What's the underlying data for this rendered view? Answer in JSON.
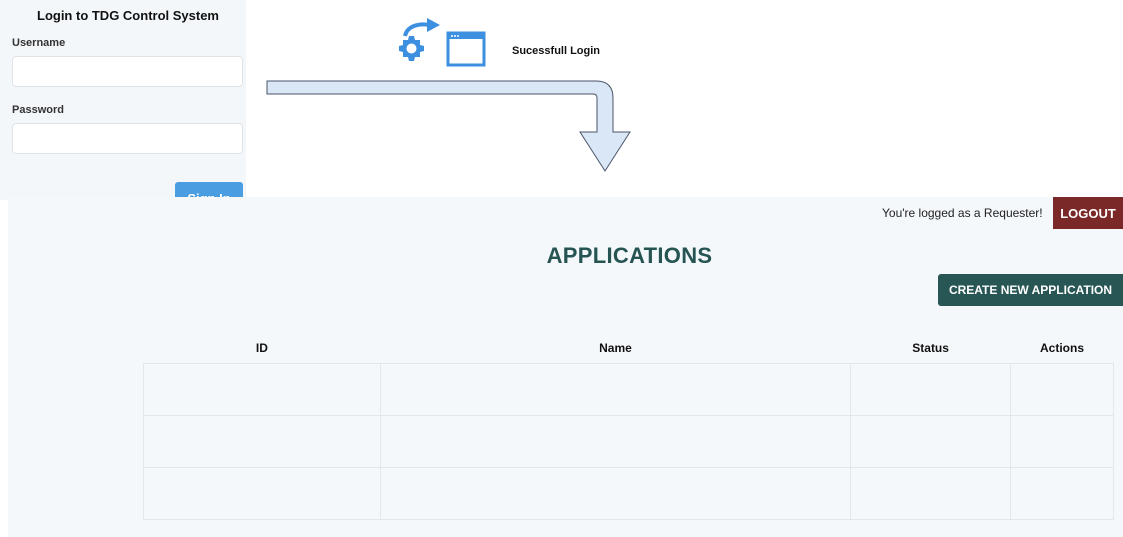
{
  "login": {
    "title": "Login to TDG Control System",
    "username_label": "Username",
    "username_value": "",
    "password_label": "Password",
    "password_value": "",
    "signin_label": "Sign In"
  },
  "transition": {
    "success_text": "Sucessfull Login",
    "icon_colors": {
      "accent": "#3d8fe0",
      "arrow_fill": "#d9e7f7"
    }
  },
  "header": {
    "logged_as": "You're logged as a Requester!",
    "logout_label": "LOGOUT"
  },
  "applications": {
    "title": "APPLICATIONS",
    "create_label": "CREATE NEW APPLICATION",
    "columns": [
      "ID",
      "Name",
      "Status",
      "Actions"
    ],
    "rows": [
      [
        "",
        "",
        "",
        ""
      ],
      [
        "",
        "",
        "",
        ""
      ],
      [
        "",
        "",
        "",
        ""
      ]
    ]
  },
  "colors": {
    "primary_teal": "#285654",
    "logout_red": "#7a2828",
    "signin_blue": "#4a9de0",
    "panel_bg": "#f4f7fa"
  }
}
